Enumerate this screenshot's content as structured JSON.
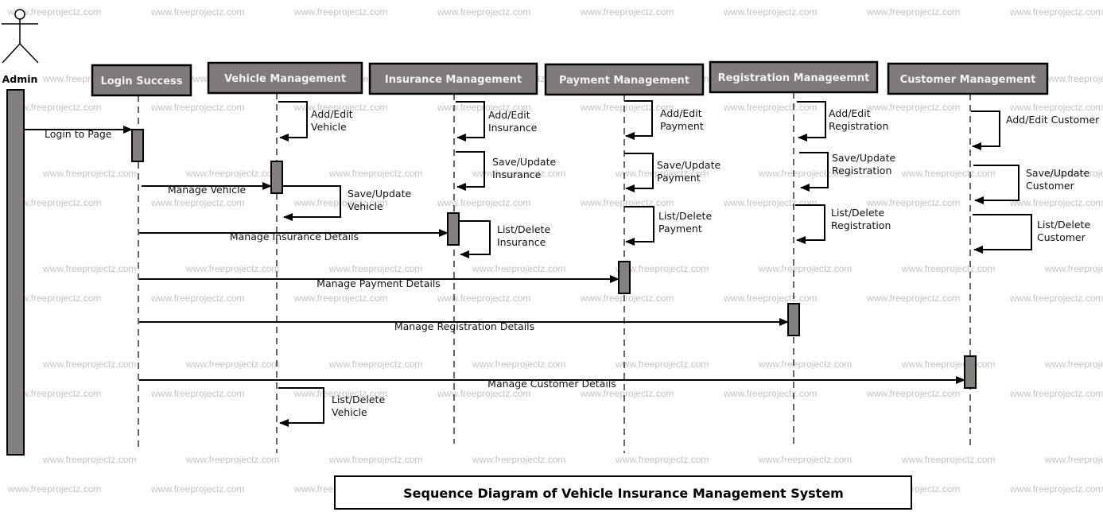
{
  "diagram": {
    "title": "Sequence Diagram of Vehicle Insurance Management System",
    "watermark": "www.freeprojectz.com",
    "colors": {
      "participant_fill": "#7f7b7b",
      "activation_fill": "#858080",
      "stroke": "#000000",
      "watermark": "#c4c4c4"
    },
    "actor": {
      "id": "admin",
      "label": "Admin",
      "icon": "stick-figure-icon"
    },
    "participants": [
      {
        "id": "login",
        "label": "Login Success"
      },
      {
        "id": "vehicle",
        "label": "Vehicle Management"
      },
      {
        "id": "insurance",
        "label": "Insurance Management"
      },
      {
        "id": "payment",
        "label": "Payment Management"
      },
      {
        "id": "registration",
        "label": "Registration Manageemnt"
      },
      {
        "id": "customer",
        "label": "Customer Management"
      }
    ],
    "messages": [
      {
        "from": "admin",
        "to": "login",
        "label": "Login to Page"
      },
      {
        "from": "login",
        "to": "vehicle",
        "label": "Manage Vehicle"
      },
      {
        "from": "login",
        "to": "insurance",
        "label": "Manage Insurance Details"
      },
      {
        "from": "login",
        "to": "payment",
        "label": "Manage Payment Details"
      },
      {
        "from": "login",
        "to": "registration",
        "label": "Manage Registration Details"
      },
      {
        "from": "login",
        "to": "customer",
        "label": "Manage Customer Details"
      }
    ],
    "self_messages": [
      {
        "on": "vehicle",
        "line1": "Add/Edit",
        "line2": "Vehicle"
      },
      {
        "on": "vehicle",
        "line1": "Save/Update",
        "line2": "Vehicle"
      },
      {
        "on": "vehicle",
        "line1": "List/Delete",
        "line2": "Vehicle"
      },
      {
        "on": "insurance",
        "line1": "Add/Edit",
        "line2": "Insurance"
      },
      {
        "on": "insurance",
        "line1": "Save/Update",
        "line2": "Insurance"
      },
      {
        "on": "insurance",
        "line1": "List/Delete",
        "line2": "Insurance"
      },
      {
        "on": "payment",
        "line1": "Add/Edit",
        "line2": "Payment"
      },
      {
        "on": "payment",
        "line1": "Save/Update",
        "line2": "Payment"
      },
      {
        "on": "payment",
        "line1": "List/Delete",
        "line2": "Payment"
      },
      {
        "on": "registration",
        "line1": "Add/Edit",
        "line2": "Registration"
      },
      {
        "on": "registration",
        "line1": "Save/Update",
        "line2": "Registration"
      },
      {
        "on": "registration",
        "line1": "List/Delete",
        "line2": "Registration"
      },
      {
        "on": "customer",
        "line1": "Add/Edit Customer",
        "line2": ""
      },
      {
        "on": "customer",
        "line1": "Save/Update",
        "line2": "Customer"
      },
      {
        "on": "customer",
        "line1": "List/Delete",
        "line2": "Customer"
      }
    ]
  }
}
